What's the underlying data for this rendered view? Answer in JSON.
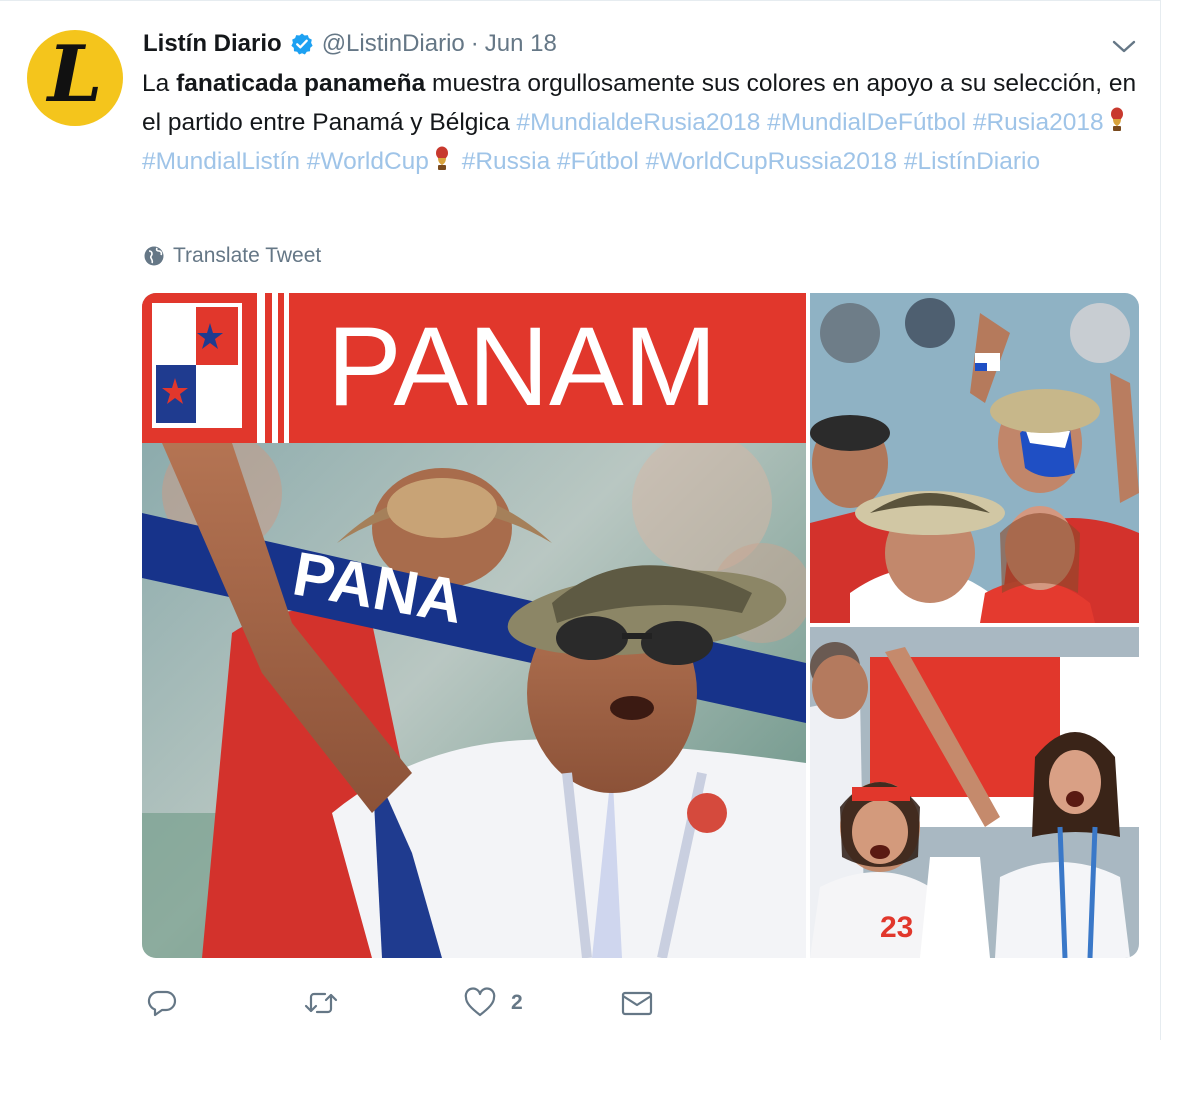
{
  "tweet": {
    "author_name": "Listín Diario",
    "author_handle": "@ListinDiario",
    "separator": "·",
    "date": "Jun 18",
    "avatar_letter": "L",
    "text_prefix": "La ",
    "text_bold": "fanaticada panameña",
    "text_body": " muestra orgullosamente sus colores en apoyo a su selección, en el partido entre Panamá y Bélgica ",
    "hashtags": [
      "#MundialdeRusia2018",
      "#MundialDeFútbol",
      "#Rusia2018",
      "#MundialListín",
      "#WorldCup",
      "#Russia",
      "#Fútbol",
      "#WorldCupRussia2018",
      "#ListínDiario"
    ],
    "translate_label": "Translate Tweet",
    "like_count": "2"
  },
  "colors": {
    "link": "#9fc4e8",
    "text": "#14171a",
    "muted": "#657786",
    "verified": "#1da1f2",
    "avatar_bg": "#f4c51c",
    "panama_red": "#d52b1e",
    "panama_blue": "#0a3d91"
  },
  "icons": {
    "verified": "verified-badge-icon",
    "caret": "chevron-down-icon",
    "globe": "globe-icon",
    "reply": "reply-icon",
    "retweet": "retweet-icon",
    "like": "heart-icon",
    "dm": "envelope-icon",
    "trophy": "trophy-emoji-icon"
  },
  "media": {
    "scarf_text_main": "PANAM",
    "scarf_text_blue": "PANA"
  }
}
